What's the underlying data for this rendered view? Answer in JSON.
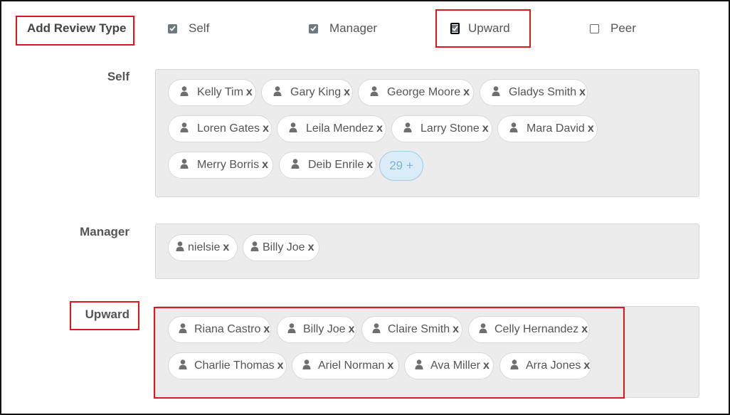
{
  "header": {
    "title": "Add Review Type",
    "types": [
      {
        "label": "Self",
        "state": "checked"
      },
      {
        "label": "Manager",
        "state": "checked"
      },
      {
        "label": "Upward",
        "state": "checked"
      },
      {
        "label": "Peer",
        "state": "unchecked"
      }
    ]
  },
  "sections": {
    "self": {
      "label": "Self",
      "chips": [
        "Kelly Tim",
        "Gary King",
        "George Moore",
        "Gladys Smith",
        "Loren Gates",
        "Leila Mendez",
        "Larry Stone",
        "Mara David",
        "Merry Borris",
        "Deib Enrile"
      ],
      "more": "29 +"
    },
    "manager": {
      "label": "Manager",
      "chips": [
        "nielsie",
        "Billy Joe"
      ]
    },
    "upward": {
      "label": "Upward",
      "chips": [
        "Riana Castro",
        "Billy Joe",
        "Claire Smith",
        "Celly Hernandez",
        "Charlie Thomas",
        "Ariel Norman",
        "Ava Miller",
        "Arra Jones"
      ]
    }
  },
  "remove_glyph": "x",
  "colors": {
    "highlight": "#e0161b",
    "more_badge": "#d9ecf7",
    "panel": "#ececec"
  }
}
